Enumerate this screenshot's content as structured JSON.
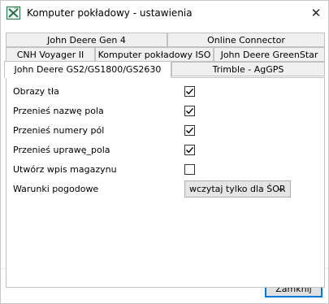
{
  "window": {
    "title": "Komputer pokładowy - ustawienia",
    "close_glyph": "✕",
    "app_icon": "excel-like-x-icon"
  },
  "tabs": {
    "row1": [
      {
        "label": "John Deere Gen 4"
      },
      {
        "label": "Online Connector"
      }
    ],
    "row2": [
      {
        "label": "CNH Voyager II"
      },
      {
        "label": "Komputer pokładowy ISO"
      },
      {
        "label": "John Deere GreenStar"
      }
    ],
    "row3": [
      {
        "label": "John Deere GS2/GS1800/GS2630",
        "selected": true
      },
      {
        "label": "Trimble - AgGPS"
      }
    ]
  },
  "options": [
    {
      "label": "Obrazy tła",
      "checked": true
    },
    {
      "label": "Przenieś nazwę pola",
      "checked": true
    },
    {
      "label": "Przenieś numery pól",
      "checked": true
    },
    {
      "label": "Przenieś uprawę_pola",
      "checked": true
    },
    {
      "label": "Utwórz wpis magazynu",
      "checked": false
    }
  ],
  "weather": {
    "label": "Warunki pogodowe",
    "selected": "wczytaj tylko dla ŚOR"
  },
  "footer": {
    "close_label": "Zamknij"
  },
  "colors": {
    "accent": "#0078d7",
    "tab_bg": "#f0f0f0",
    "icon_green": "#1e7145"
  }
}
